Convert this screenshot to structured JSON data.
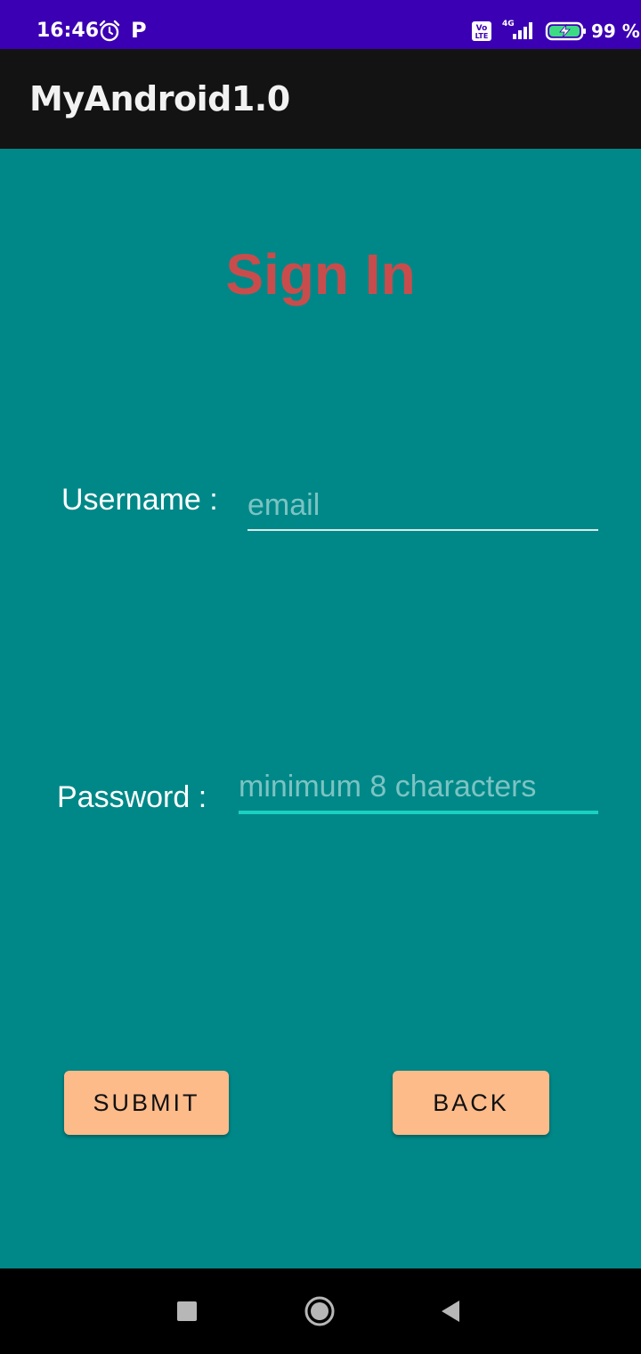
{
  "status_bar": {
    "time": "16:46",
    "p_label": "P",
    "battery": "99 %",
    "network": "4G",
    "icons": [
      "alarm-icon",
      "volte-icon",
      "signal-icon",
      "battery-charging-icon"
    ]
  },
  "app_bar": {
    "title": "MyAndroid1.0"
  },
  "form": {
    "heading": "Sign In",
    "username_label": "Username :",
    "username_placeholder": "email",
    "password_label": "Password :",
    "password_placeholder": "minimum 8 characters",
    "submit_label": "SUBMIT",
    "back_label": "BACK"
  },
  "nav_bar": {
    "icons": [
      "recents-icon",
      "home-icon",
      "back-icon"
    ]
  },
  "colors": {
    "status_bar": "#3c00b4",
    "app_bar": "#131313",
    "background": "#008888",
    "heading": "#c94c4c",
    "button": "#fdbb8a",
    "focus_underline": "#1ad1c1"
  }
}
